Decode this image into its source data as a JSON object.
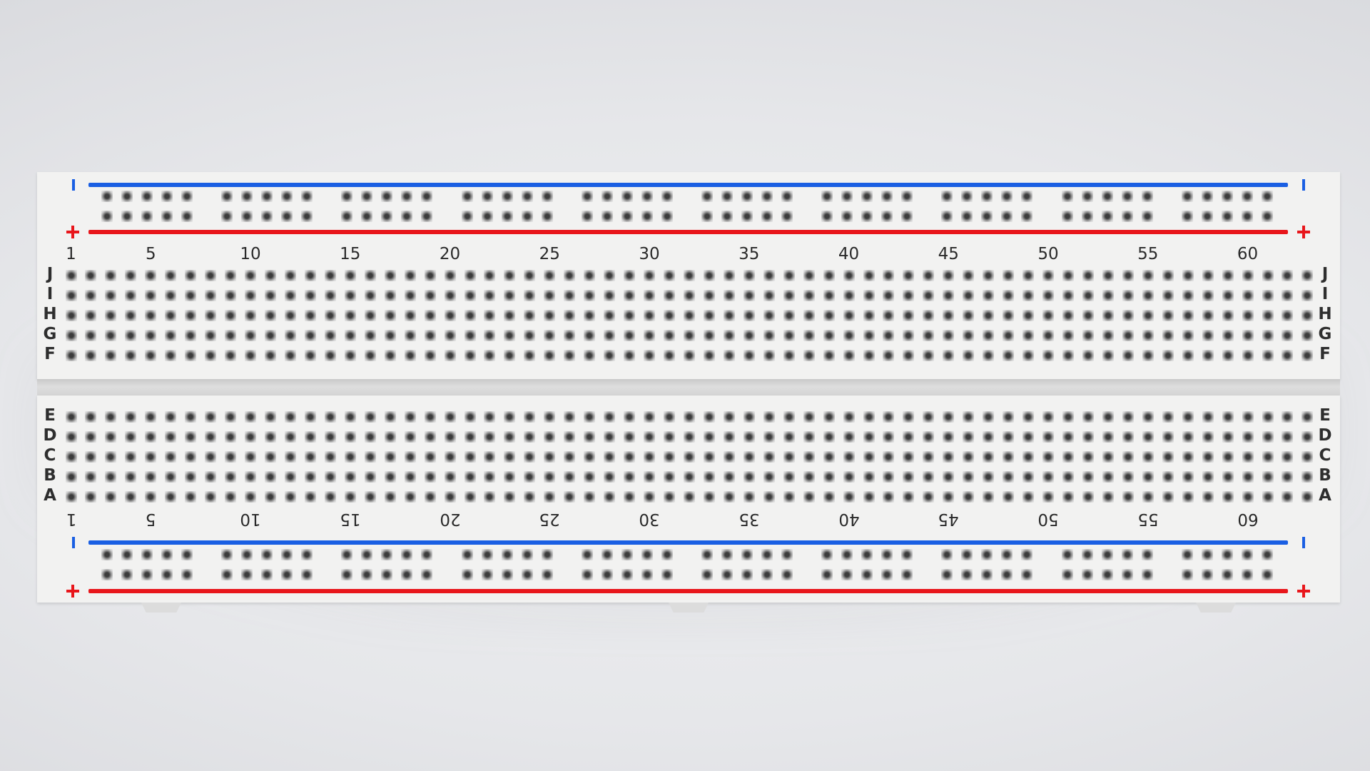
{
  "scene": {
    "subject": "breadboard-830",
    "background_color": "#e6e7ea",
    "board_color": "#f2f2f1",
    "blue_rail_color": "#1a5fe3",
    "red_rail_color": "#e8161b"
  },
  "board": {
    "columns": 63,
    "top_block_rows": [
      "J",
      "I",
      "H",
      "G",
      "F"
    ],
    "bottom_block_rows": [
      "E",
      "D",
      "C",
      "B",
      "A"
    ],
    "column_labels": [
      "1",
      "5",
      "10",
      "15",
      "20",
      "25",
      "30",
      "35",
      "40",
      "45",
      "50",
      "55",
      "60"
    ],
    "power_rail_groups": 10,
    "power_rail_holes_per_group": 5,
    "rail_minus_symbol": "|",
    "rail_plus_symbol": "+"
  }
}
